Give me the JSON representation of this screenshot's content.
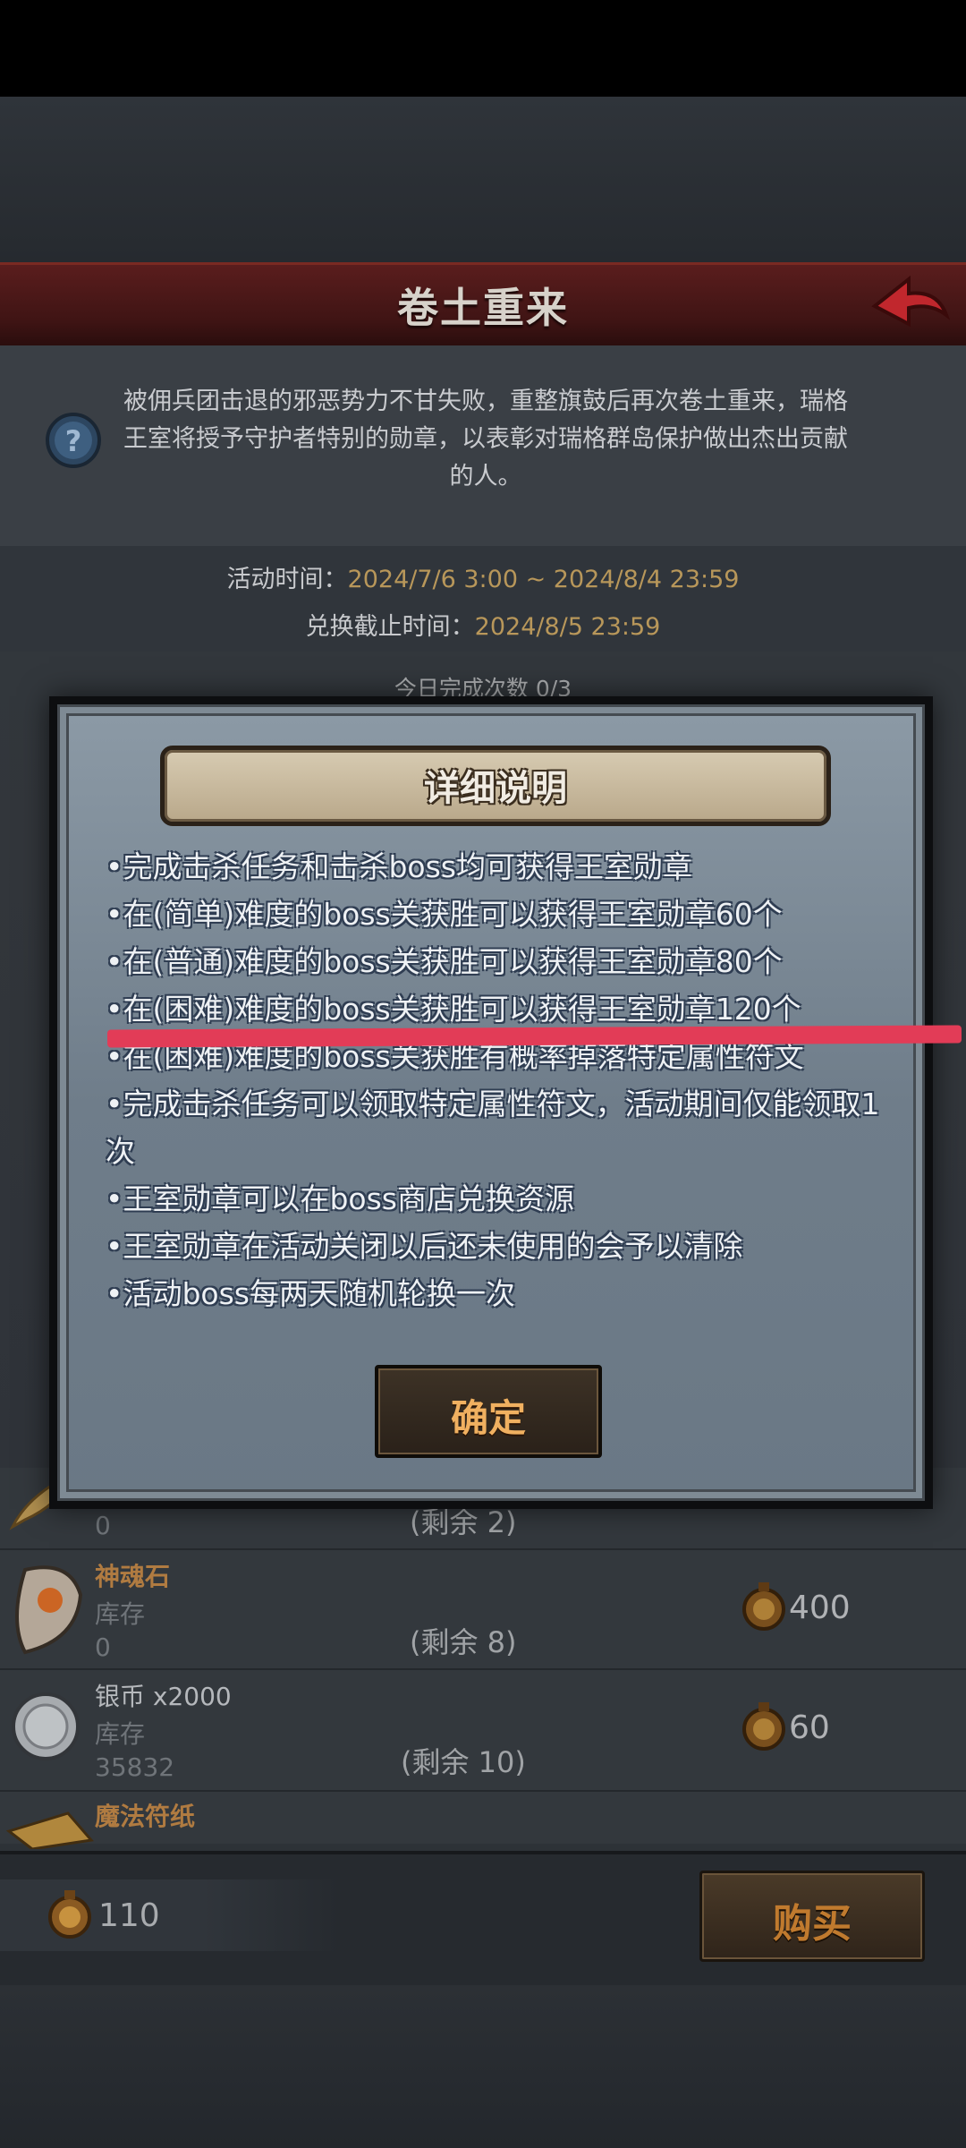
{
  "header": {
    "title": "卷土重来"
  },
  "description": "被佣兵团击退的邪恶势力不甘失败，重整旗鼓后再次卷土重来，瑞格王室将授予守护者特别的勋章，以表彰对瑞格群岛保护做出杰出贡献的人。",
  "event_time": {
    "label": "活动时间：",
    "value": "2024/7/6 3:00 ~ 2024/8/4 23:59"
  },
  "exchange_deadline": {
    "label": "兑换截止时间：",
    "value": "2024/8/5 23:59"
  },
  "daily_count": "今日完成次数 0/3",
  "shop": {
    "items": [
      {
        "name": "",
        "stock_label": "库存",
        "stock": "0",
        "remaining": "(剩余 2)",
        "price": ""
      },
      {
        "name": "神魂石",
        "stock_label": "库存",
        "stock": "0",
        "remaining": "(剩余 8)",
        "price": "400"
      },
      {
        "name": "银币 x2000",
        "stock_label": "库存",
        "stock": "35832",
        "remaining": "(剩余 10)",
        "price": "60"
      },
      {
        "name": "魔法符纸",
        "stock_label": "",
        "stock": "",
        "remaining": "",
        "price": ""
      }
    ]
  },
  "footer": {
    "coin_balance": "110",
    "buy_label": "购买"
  },
  "modal": {
    "title": "详细说明",
    "rules": [
      "•完成击杀任务和击杀boss均可获得王室勋章",
      "•在(简单)难度的boss关获胜可以获得王室勋章60个",
      "•在(普通)难度的boss关获胜可以获得王室勋章80个",
      "•在(困难)难度的boss关获胜可以获得王室勋章120个",
      "•在(困难)难度的boss关获胜有概率掉落特定属性符文",
      "•完成击杀任务可以领取特定属性符文，活动期间仅能领取1次",
      "•王室勋章可以在boss商店兑换资源",
      "•王室勋章在活动关闭以后还未使用的会予以清除",
      "•活动boss每两天随机轮换一次"
    ],
    "confirm_label": "确定"
  },
  "colors": {
    "accent_gold": "#b8975a",
    "banner_red": "#4a1818",
    "annotation_red": "#e23c57"
  }
}
